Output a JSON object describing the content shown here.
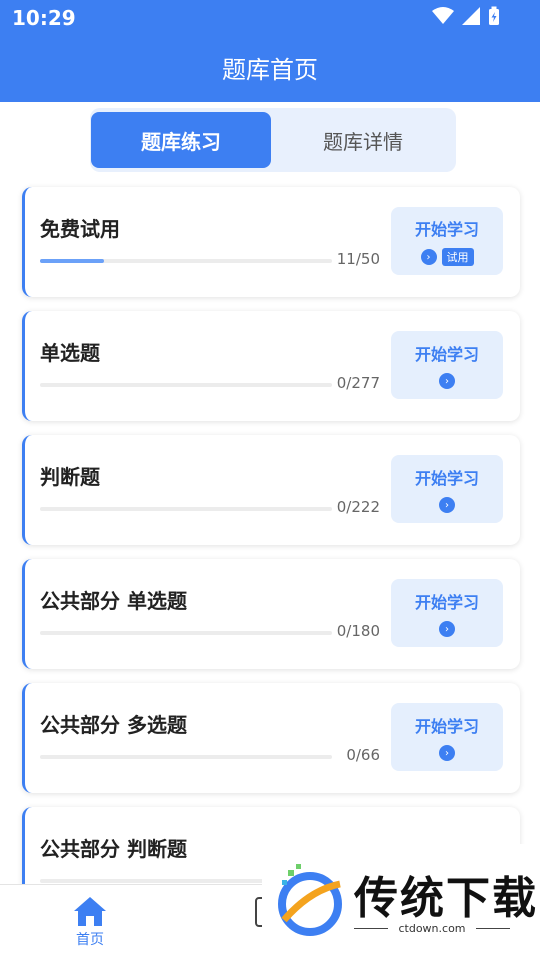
{
  "status_bar": {
    "time": "10:29"
  },
  "header": {
    "title": "题库首页"
  },
  "tabs": [
    {
      "label": "题库练习",
      "active": true
    },
    {
      "label": "题库详情",
      "active": false
    }
  ],
  "cards": [
    {
      "title": "免费试用",
      "count": "11/50",
      "progress": 0.22,
      "button": "开始学习",
      "badge": "试用"
    },
    {
      "title": "单选题",
      "count": "0/277",
      "progress": 0,
      "button": "开始学习"
    },
    {
      "title": "判断题",
      "count": "0/222",
      "progress": 0,
      "button": "开始学习"
    },
    {
      "title": "公共部分 单选题",
      "count": "0/180",
      "progress": 0,
      "button": "开始学习"
    },
    {
      "title": "公共部分 多选题",
      "count": "0/66",
      "progress": 0,
      "button": "开始学习"
    },
    {
      "title": "公共部分 判断题",
      "count": "",
      "progress": 0,
      "button": ""
    }
  ],
  "bottom_nav": {
    "home_label": "首页"
  },
  "watermark": {
    "brand": "传统下载",
    "site": "ctdown.com"
  },
  "colors": {
    "primary": "#3d7ff2",
    "tab_bg": "#e8f0fd",
    "button_bg": "#e5effd"
  }
}
